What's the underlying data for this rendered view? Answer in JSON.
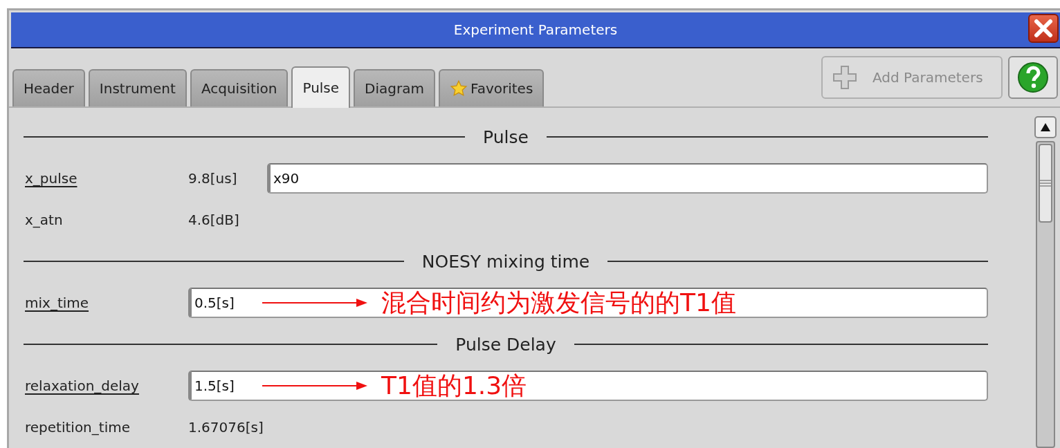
{
  "window": {
    "title": "Experiment Parameters"
  },
  "tabs": [
    {
      "label": "Header",
      "selected": false
    },
    {
      "label": "Instrument",
      "selected": false
    },
    {
      "label": "Acquisition",
      "selected": false
    },
    {
      "label": "Pulse",
      "selected": true
    },
    {
      "label": "Diagram",
      "selected": false
    },
    {
      "label": "Favorites",
      "selected": false,
      "kind": "favorites"
    }
  ],
  "toolbar": {
    "add_button": {
      "label": "Add Parameters",
      "disabled": true
    }
  },
  "rows": [
    {
      "kind": "section",
      "title": "Pulse"
    },
    {
      "kind": "param",
      "name": "x_pulse",
      "linked": true,
      "value": "9.8[us]",
      "field": "x90"
    },
    {
      "kind": "param",
      "name": "x_atn",
      "linked": false,
      "value": "4.6[dB]"
    },
    {
      "kind": "section",
      "title": "NOESY mixing time"
    },
    {
      "kind": "param",
      "name": "mix_time",
      "linked": true,
      "field": "0.5[s]",
      "annotation": "混合时间约为激发信号的的T1值"
    },
    {
      "kind": "section",
      "title": "Pulse Delay"
    },
    {
      "kind": "param",
      "name": "relaxation_delay",
      "linked": true,
      "field": "1.5[s]",
      "annotation": "T1值的1.3倍"
    },
    {
      "kind": "param",
      "name": "repetition_time",
      "linked": false,
      "value": "1.67076[s]"
    }
  ]
}
